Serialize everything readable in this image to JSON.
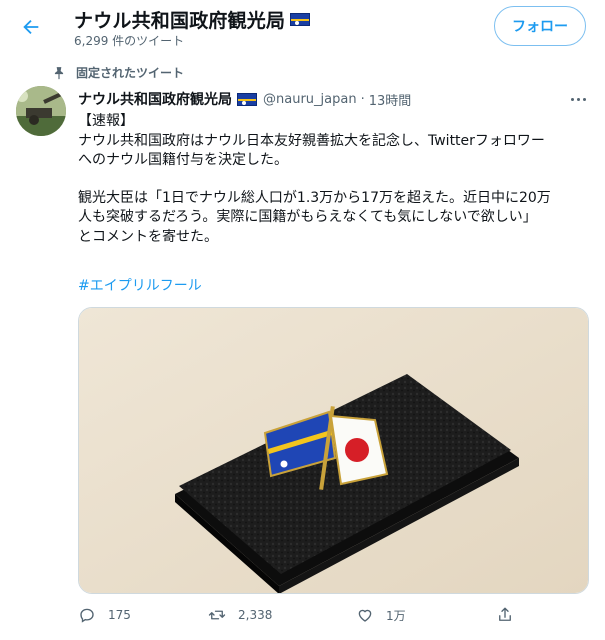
{
  "header": {
    "back_icon": "arrow-left-icon",
    "title": "ナウル共和国政府観光局",
    "tweet_count": "6,299 件のツイート",
    "follow_label": "フォロー",
    "accent_color": "#1d9bf0"
  },
  "pinned": {
    "icon": "pin-icon",
    "label": "固定されたツイート"
  },
  "tweet": {
    "author_name": "ナウル共和国政府観光局",
    "handle": "@nauru_japan",
    "separator": "·",
    "time": "13時間",
    "more_icon": "more-horizontal-icon",
    "text_lines": [
      "【速報】",
      "ナウル共和国政府はナウル日本友好親善拡大を記念し、Twitterフォロワー",
      "へのナウル国籍付与を決定した。",
      "",
      "観光大臣は「1日でナウル総人口が1.3万から17万を超えた。近日中に20万",
      "人も突破するだろう。実際に国籍がもらえなくても気にしないで欲しい」",
      "とコメントを寄せた。"
    ],
    "hashtag": "#エイプリルフール",
    "media_icon": "flag-pin-photo"
  },
  "actions": {
    "reply": {
      "icon": "reply-icon",
      "count": "175"
    },
    "retweet": {
      "icon": "retweet-icon",
      "count": "2,338"
    },
    "like": {
      "icon": "heart-icon",
      "count": "1万"
    },
    "share": {
      "icon": "share-icon"
    }
  }
}
